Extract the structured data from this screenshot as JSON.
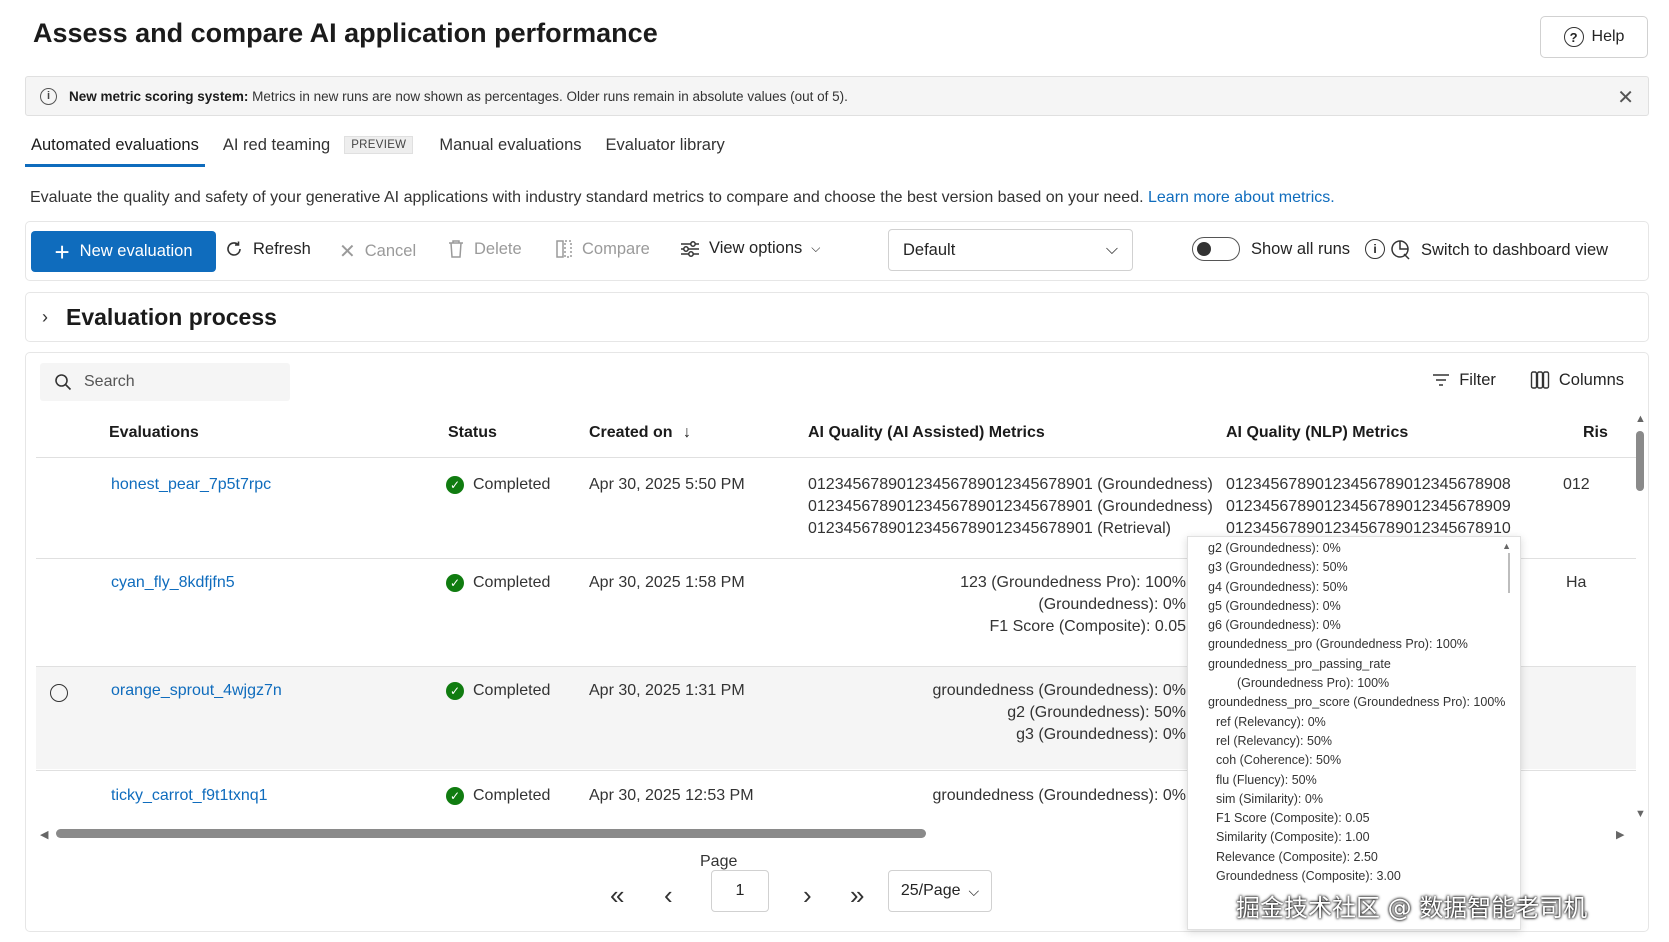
{
  "page": {
    "title": "Assess and compare AI application performance",
    "help_label": "Help"
  },
  "banner": {
    "bold": "New metric scoring system:",
    "text": " Metrics in new runs are now shown as percentages. Older runs remain in absolute values (out of 5)."
  },
  "tabs": [
    {
      "label": "Automated evaluations",
      "active": true
    },
    {
      "label": "AI red teaming",
      "badge": "PREVIEW"
    },
    {
      "label": "Manual evaluations"
    },
    {
      "label": "Evaluator library"
    }
  ],
  "description": {
    "text": "Evaluate the quality and safety of your generative AI applications with industry standard metrics to compare and choose the best version based on your need. ",
    "link": "Learn more about metrics."
  },
  "toolbar": {
    "new_evaluation": "New evaluation",
    "refresh": "Refresh",
    "cancel": "Cancel",
    "delete": "Delete",
    "compare": "Compare",
    "view_options": "View options",
    "view_select": "Default",
    "show_all_runs": "Show all runs",
    "dashboard": "Switch to dashboard view"
  },
  "process": {
    "label": "Evaluation process"
  },
  "table": {
    "search_placeholder": "Search",
    "filter": "Filter",
    "columns_btn": "Columns",
    "headers": {
      "evaluations": "Evaluations",
      "status": "Status",
      "created": "Created on",
      "ai_assisted": "AI Quality (AI Assisted) Metrics",
      "nlp": "AI Quality (NLP) Metrics",
      "risk": "Ris"
    },
    "rows": [
      {
        "name": "honest_pear_7p5t7rpc",
        "status": "Completed",
        "created": "Apr 30, 2025 5:50 PM",
        "ai": [
          "0123456789012345678901234567890​1 (Groundedness)",
          "01234567890123456789012345678901 (Groundedness)",
          "01234567890123456789012345678901 (Retrieval)"
        ],
        "nlp": [
          "012345678901234567890123456789​08",
          "01234567890123456789012345678909",
          "01234567890123456789012345678910"
        ],
        "risk": "012"
      },
      {
        "name": "cyan_fly_8kdfjfn5",
        "status": "Completed",
        "created": "Apr 30, 2025 1:58 PM",
        "ai": [
          "123 (Groundedness Pro): 100%",
          "(Groundedness): 0%",
          "F1 Score (Composite): 0.05"
        ],
        "risk": "Ha"
      },
      {
        "name": "orange_sprout_4wjgz7n",
        "status": "Completed",
        "created": "Apr 30, 2025 1:31 PM",
        "ai": [
          "groundedness (Groundedness): 0%",
          "g2 (Groundedness): 50%",
          "g3 (Groundedness): 0%"
        ]
      },
      {
        "name": "ticky_carrot_f9t1txnq1",
        "status": "Completed",
        "created": "Apr 30, 2025 12:53 PM",
        "ai": [
          "groundedness (Groundedness): 0%"
        ]
      }
    ]
  },
  "pager": {
    "label": "Page",
    "current": "1",
    "size": "25/Page"
  },
  "popup": {
    "lines": [
      "g2 (Groundedness): 0%",
      "g3 (Groundedness): 50%",
      "g4 (Groundedness): 50%",
      "g5 (Groundedness): 0%",
      "g6 (Groundedness): 0%",
      "groundedness_pro (Groundedness Pro): 100%",
      "groundedness_pro_passing_rate",
      "(Groundedness Pro): 100%",
      "groundedness_pro_score (Groundedness Pro): 100%",
      "ref (Relevancy): 0%",
      "rel (Relevancy): 50%",
      "coh (Coherence): 50%",
      "flu (Fluency): 50%",
      "sim (Similarity): 0%",
      "F1 Score (Composite): 0.05",
      "Similarity (Composite): 1.00",
      "Relevance (Composite): 2.50",
      "Groundedness (Composite): 3.00"
    ]
  },
  "watermark": "掘金技术社区 @ 数据智能老司机",
  "colors": {
    "accent": "#0f6cbd",
    "success": "#107c10"
  }
}
